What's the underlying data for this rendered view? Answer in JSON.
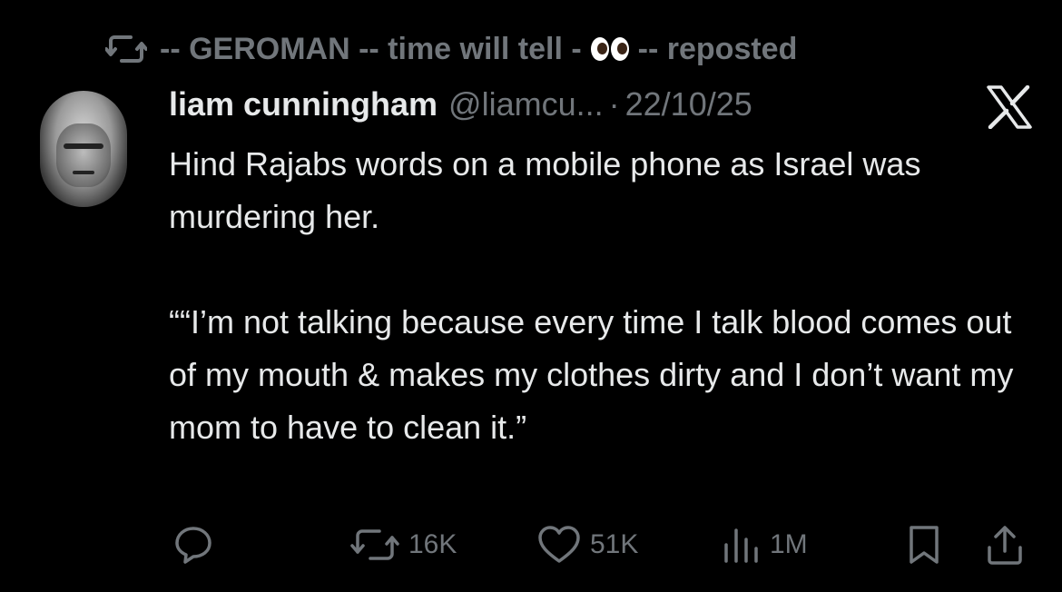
{
  "repost": {
    "before_emoji": "-- GEROMAN -- time will tell -",
    "after_emoji": "-- reposted",
    "emoji": "eyes-emoji"
  },
  "tweet": {
    "name": "liam cunningham",
    "handle": "@liamcu...",
    "separator": "·",
    "date": "22/10/25",
    "paragraph_1": "Hind Rajabs words on a mobile phone as Israel was murdering her.",
    "paragraph_2": "““I’m not talking because every time I talk blood comes out of my mouth  & makes my clothes dirty and I don’t want my mom to have to clean it.”"
  },
  "actions": {
    "reposts": "16K",
    "likes": "51K",
    "views": "1M"
  },
  "icons": [
    "repost-icon",
    "x-logo-icon",
    "reply-icon",
    "like-icon",
    "views-icon",
    "bookmark-icon",
    "share-icon"
  ],
  "colors": {
    "background": "#000000",
    "text": "#e7e9ea",
    "muted": "#71767b"
  }
}
